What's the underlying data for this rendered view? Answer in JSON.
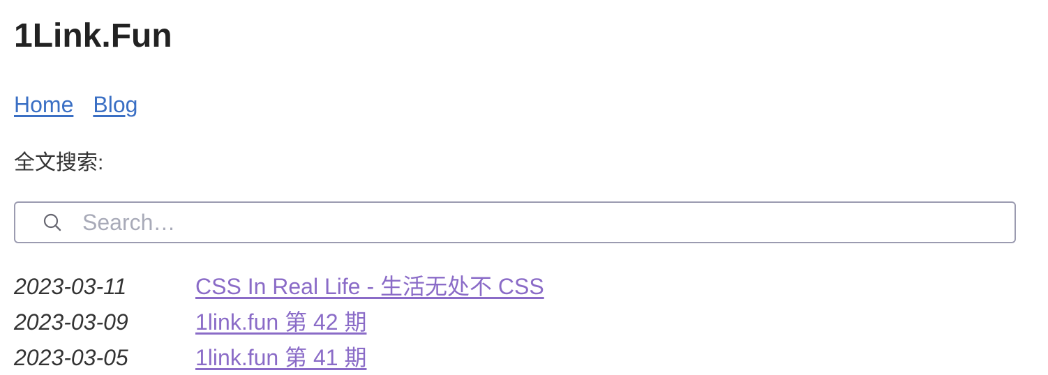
{
  "site": {
    "title": "1Link.Fun"
  },
  "nav": {
    "items": [
      {
        "label": "Home"
      },
      {
        "label": "Blog"
      }
    ]
  },
  "search": {
    "label": "全文搜索:",
    "placeholder": "Search…",
    "value": "",
    "icon": "search-icon"
  },
  "posts": [
    {
      "date": "2023-03-11",
      "title": "CSS In Real Life - 生活无处不 CSS"
    },
    {
      "date": "2023-03-09",
      "title": "1link.fun 第 42 期"
    },
    {
      "date": "2023-03-05",
      "title": "1link.fun 第 41 期"
    }
  ],
  "colors": {
    "link": "#3a6fc4",
    "visited_link": "#8a6bc7",
    "text": "#222222",
    "border": "#9b9bb0"
  }
}
